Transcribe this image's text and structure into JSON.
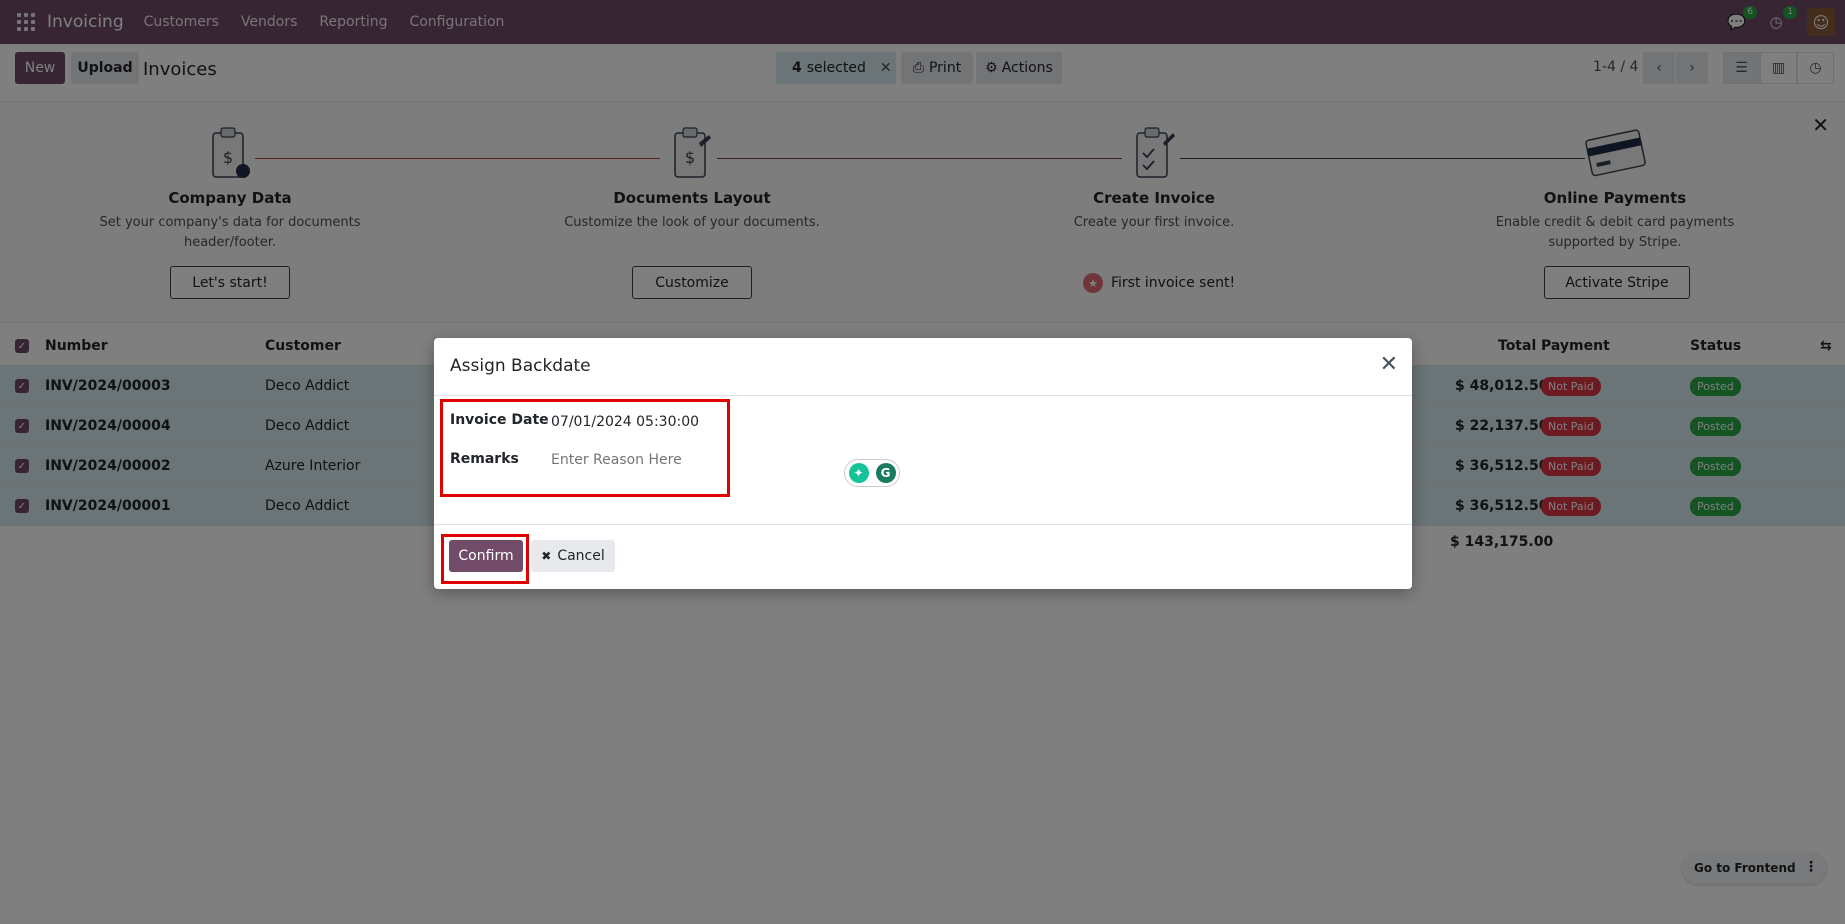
{
  "nav": {
    "app_name": "Invoicing",
    "menus": [
      "Customers",
      "Vendors",
      "Reporting",
      "Configuration"
    ],
    "chat_count": "6",
    "activity_count": "1"
  },
  "control": {
    "new_label": "New",
    "upload_label": "Upload",
    "breadcrumb": "Invoices",
    "selected_count": "4",
    "selected_text": "selected",
    "print_label": "Print",
    "actions_label": "Actions",
    "pager": "1-4 / 4"
  },
  "onboarding": {
    "steps": [
      {
        "title": "Company Data",
        "desc1": "Set your company's data for documents",
        "desc2": "header/footer.",
        "button": "Let's start!"
      },
      {
        "title": "Documents Layout",
        "desc1": "Customize the look of your documents.",
        "desc2": "",
        "button": "Customize"
      },
      {
        "title": "Create Invoice",
        "desc1": "Create your first invoice.",
        "desc2": "",
        "done": "First invoice sent!"
      },
      {
        "title": "Online Payments",
        "desc1": "Enable credit & debit card payments",
        "desc2": "supported by Stripe.",
        "button": "Activate Stripe"
      }
    ]
  },
  "table": {
    "headers": {
      "number": "Number",
      "customer": "Customer",
      "total": "Total",
      "payment": "Payment",
      "status": "Status"
    },
    "rows": [
      {
        "number": "INV/2024/00003",
        "customer": "Deco Addict",
        "total": "$ 48,012.50",
        "payment": "Not Paid",
        "status": "Posted"
      },
      {
        "number": "INV/2024/00004",
        "customer": "Deco Addict",
        "total": "$ 22,137.50",
        "payment": "Not Paid",
        "status": "Posted"
      },
      {
        "number": "INV/2024/00002",
        "customer": "Azure Interior",
        "total": "$ 36,512.50",
        "payment": "Not Paid",
        "status": "Posted"
      },
      {
        "number": "INV/2024/00001",
        "customer": "Deco Addict",
        "total": "$ 36,512.50",
        "payment": "Not Paid",
        "status": "Posted"
      }
    ],
    "grand_total": "$ 143,175.00"
  },
  "modal": {
    "title": "Assign Backdate",
    "invoice_date_label": "Invoice Date",
    "invoice_date_value": "07/01/2024 05:30:00",
    "remarks_label": "Remarks",
    "remarks_placeholder": "Enter Reason Here",
    "confirm_label": "Confirm",
    "cancel_label": "Cancel"
  },
  "frontend": {
    "label": "Go to Frontend"
  },
  "colors": {
    "brand": "#714B67",
    "highlight": "#e10000",
    "selected_row": "#d6e8ef"
  }
}
